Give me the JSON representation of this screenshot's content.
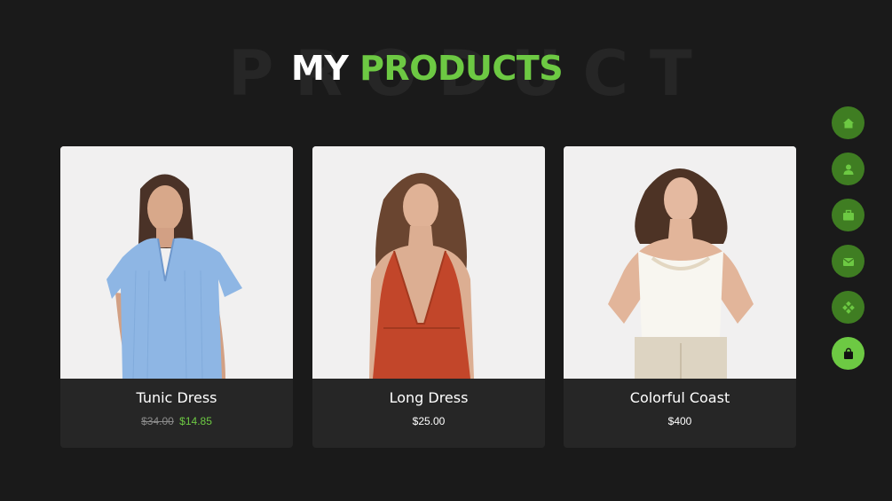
{
  "heading": {
    "background_text": "PRODUCT",
    "title_white": "MY",
    "title_green": "PRODUCTS"
  },
  "colors": {
    "accent": "#6dc943",
    "nav_inactive": "#3f7d22",
    "background": "#1a1a1a",
    "card": "#262626"
  },
  "products": [
    {
      "name": "Tunic Dress",
      "old_price": "$34.00",
      "price": "$14.85",
      "image": "woman-blue-shirt"
    },
    {
      "name": "Long Dress",
      "price": "$25.00",
      "image": "woman-red-dress"
    },
    {
      "name": "Colorful Coast",
      "price": "$400",
      "image": "woman-white-top"
    }
  ],
  "side_nav": [
    {
      "icon": "home-icon",
      "active": false
    },
    {
      "icon": "user-icon",
      "active": false
    },
    {
      "icon": "briefcase-icon",
      "active": false
    },
    {
      "icon": "envelope-icon",
      "active": false
    },
    {
      "icon": "grid-diamond-icon",
      "active": false
    },
    {
      "icon": "shopping-bag-icon",
      "active": true
    }
  ]
}
